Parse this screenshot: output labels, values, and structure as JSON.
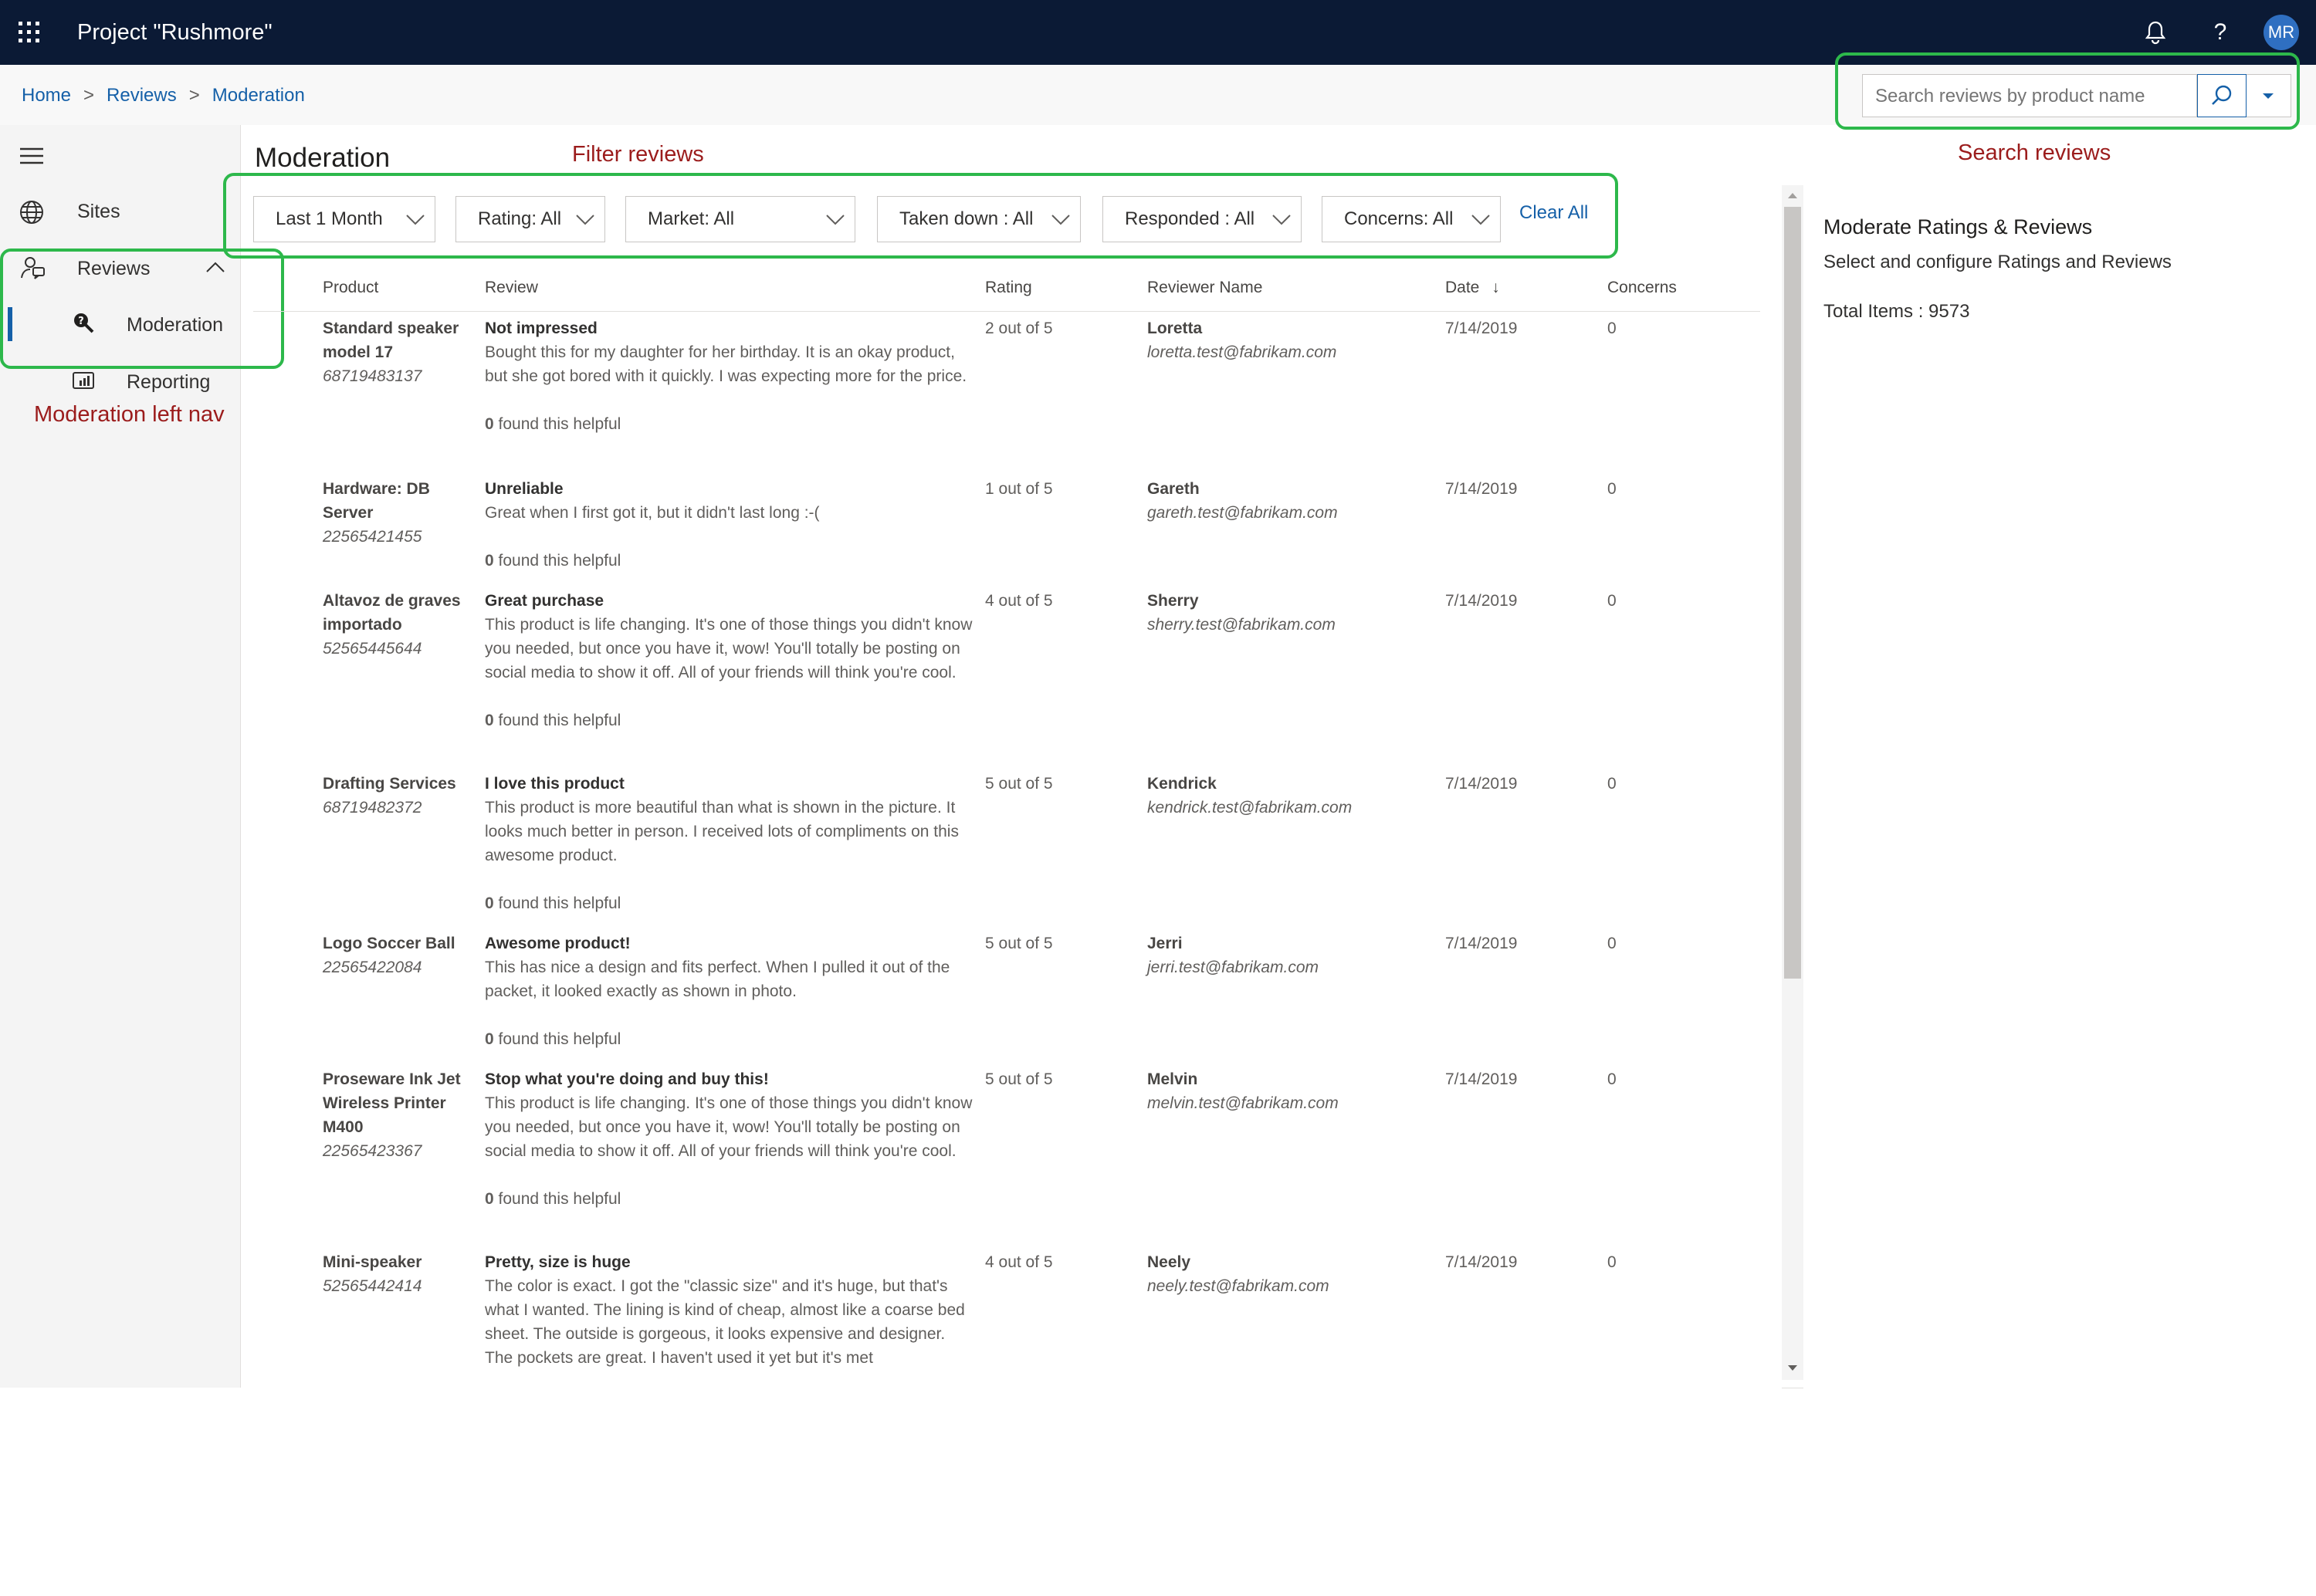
{
  "app": {
    "title": "Project \"Rushmore\"",
    "avatar_initials": "MR"
  },
  "header": {
    "notifications_icon": "bell-icon",
    "help_icon": "question-icon",
    "help_glyph": "?"
  },
  "breadcrumb": {
    "items": [
      "Home",
      "Reviews",
      "Moderation"
    ],
    "separator": ">"
  },
  "search": {
    "placeholder": "Search reviews by product name",
    "icon": "search-icon"
  },
  "leftnav": {
    "items": [
      {
        "label": "Sites",
        "icon": "globe-icon"
      },
      {
        "label": "Reviews",
        "icon": "reviews-icon"
      },
      {
        "label": "Moderation",
        "icon": "moderation-icon",
        "active": true
      },
      {
        "label": "Reporting",
        "icon": "report-icon"
      }
    ]
  },
  "annotations": {
    "filter": "Filter reviews",
    "search": "Search reviews",
    "leftnav": "Moderation left nav",
    "color": "#2db84b",
    "text_color": "#9b1c1c"
  },
  "page": {
    "title": "Moderation"
  },
  "filters": {
    "items": [
      "Last 1 Month",
      "Rating: All",
      "Market: All",
      "Taken down : All",
      "Responded : All",
      "Concerns: All"
    ],
    "clear_all": "Clear All"
  },
  "table": {
    "columns": [
      "Product",
      "Review",
      "Rating",
      "Reviewer Name",
      "Date",
      "Concerns"
    ],
    "sort_indicator": "↓",
    "helpful_suffix": " found this helpful",
    "rows": [
      {
        "product": "Standard speaker model 17",
        "code": "68719483137",
        "title": "Not impressed",
        "text": "Bought this for my daughter for her birthday. It is an okay product, but she got bored with it quickly. I was expecting more for the price.",
        "helpful": "0",
        "rating": "2 out of 5",
        "name": "Loretta",
        "email": "loretta.test@fabrikam.com",
        "date": "7/14/2019",
        "concerns": "0"
      },
      {
        "product": "Hardware: DB Server",
        "code": "22565421455",
        "title": "Unreliable",
        "text": "Great when I first got it, but it didn't last long :-(",
        "helpful": "0",
        "rating": "1 out of 5",
        "name": "Gareth",
        "email": "gareth.test@fabrikam.com",
        "date": "7/14/2019",
        "concerns": "0"
      },
      {
        "product": "Altavoz de graves importado",
        "code": "52565445644",
        "title": "Great purchase",
        "text": "This product is life changing. It's one of those things you didn't know you needed, but once you have it, wow! You'll totally be posting on social media to show it off. All of your friends will think you're cool.",
        "helpful": "0",
        "rating": "4 out of 5",
        "name": "Sherry",
        "email": "sherry.test@fabrikam.com",
        "date": "7/14/2019",
        "concerns": "0"
      },
      {
        "product": "Drafting Services",
        "code": "68719482372",
        "title": "I love this product",
        "text": "This product is more beautiful than what is shown in the picture. It looks much better in person. I received lots of compliments on this awesome product.",
        "helpful": "0",
        "rating": "5 out of 5",
        "name": "Kendrick",
        "email": "kendrick.test@fabrikam.com",
        "date": "7/14/2019",
        "concerns": "0"
      },
      {
        "product": "Logo Soccer Ball",
        "code": "22565422084",
        "title": "Awesome product!",
        "text": "This has nice a design and fits perfect. When I pulled it out of the packet, it looked exactly as shown in photo.",
        "helpful": "0",
        "rating": "5 out of 5",
        "name": "Jerri",
        "email": "jerri.test@fabrikam.com",
        "date": "7/14/2019",
        "concerns": "0"
      },
      {
        "product": "Proseware Ink Jet Wireless Printer M400",
        "code": "22565423367",
        "title": "Stop what you're doing and buy this!",
        "text": "This product is life changing. It's one of those things you didn't know you needed, but once you have it, wow! You'll totally be posting on social media to show it off. All of your friends will think you're cool.",
        "helpful": "0",
        "rating": "5 out of 5",
        "name": "Melvin",
        "email": "melvin.test@fabrikam.com",
        "date": "7/14/2019",
        "concerns": "0"
      },
      {
        "product": "Mini-speaker",
        "code": "52565442414",
        "title": "Pretty, size is huge",
        "text": "The color is exact. I got the \"classic size\" and it's huge, but that's what I wanted. The lining is kind of cheap, almost like a coarse bed sheet. The outside is gorgeous, it looks expensive and designer. The pockets are great. I haven't used it yet but it's met",
        "helpful": "",
        "rating": "4 out of 5",
        "name": "Neely",
        "email": "neely.test@fabrikam.com",
        "date": "7/14/2019",
        "concerns": "0"
      }
    ]
  },
  "right_panel": {
    "title": "Moderate Ratings & Reviews",
    "subtitle": "Select and configure Ratings and Reviews",
    "total_label": "Total Items : 9573"
  },
  "colors": {
    "topbar": "#0b1a35",
    "link": "#1560a8",
    "avatar": "#2f6fc1"
  }
}
